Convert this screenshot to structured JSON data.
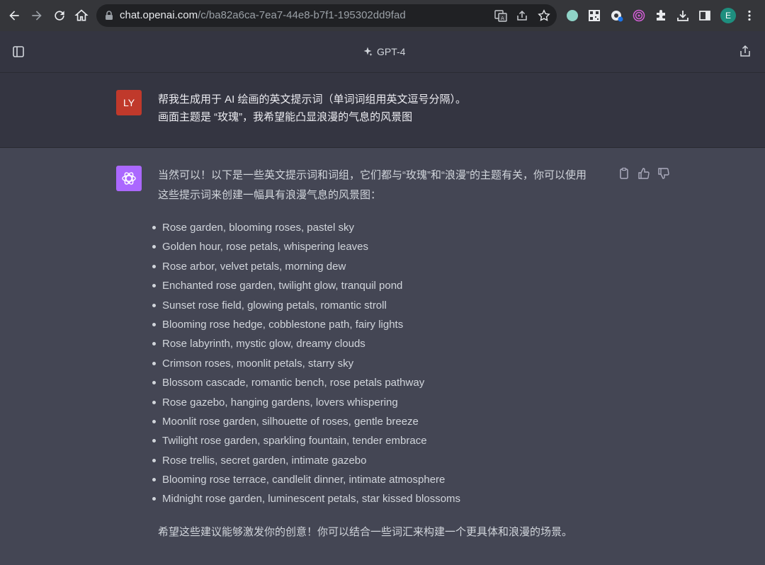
{
  "browser": {
    "url_host": "chat.openai.com",
    "url_path": "/c/ba82a6ca-7ea7-44e8-b7f1-195302dd9fad",
    "profile_initial": "E"
  },
  "header": {
    "model_title": "GPT-4"
  },
  "user_message": {
    "avatar_initials": "LY",
    "line1": "帮我生成用于 AI 绘画的英文提示词（单词词组用英文逗号分隔）。",
    "line2": "画面主题是 “玫瑰”，我希望能凸显浪漫的气息的风景图"
  },
  "assistant_message": {
    "intro_line1": "当然可以！以下是一些英文提示词和词组，它们都与“玫瑰”和“浪漫”的主题有关，你可以使用",
    "intro_line2": "这些提示词来创建一幅具有浪漫气息的风景图：",
    "items": [
      "Rose garden, blooming roses, pastel sky",
      "Golden hour, rose petals, whispering leaves",
      "Rose arbor, velvet petals, morning dew",
      "Enchanted rose garden, twilight glow, tranquil pond",
      "Sunset rose field, glowing petals, romantic stroll",
      "Blooming rose hedge, cobblestone path, fairy lights",
      "Rose labyrinth, mystic glow, dreamy clouds",
      "Crimson roses, moonlit petals, starry sky",
      "Blossom cascade, romantic bench, rose petals pathway",
      "Rose gazebo, hanging gardens, lovers whispering",
      "Moonlit rose garden, silhouette of roses, gentle breeze",
      "Twilight rose garden, sparkling fountain, tender embrace",
      "Rose trellis, secret garden, intimate gazebo",
      "Blooming rose terrace, candlelit dinner, intimate atmosphere",
      "Midnight rose garden, luminescent petals, star kissed blossoms"
    ],
    "outro": "希望这些建议能够激发你的创意！你可以结合一些词汇来构建一个更具体和浪漫的场景。"
  },
  "colors": {
    "browser_bar": "#35363a",
    "app_header": "#343541",
    "assistant_bg": "#444654",
    "user_avatar": "#c0392b",
    "bot_avatar": "#ab68ff"
  }
}
